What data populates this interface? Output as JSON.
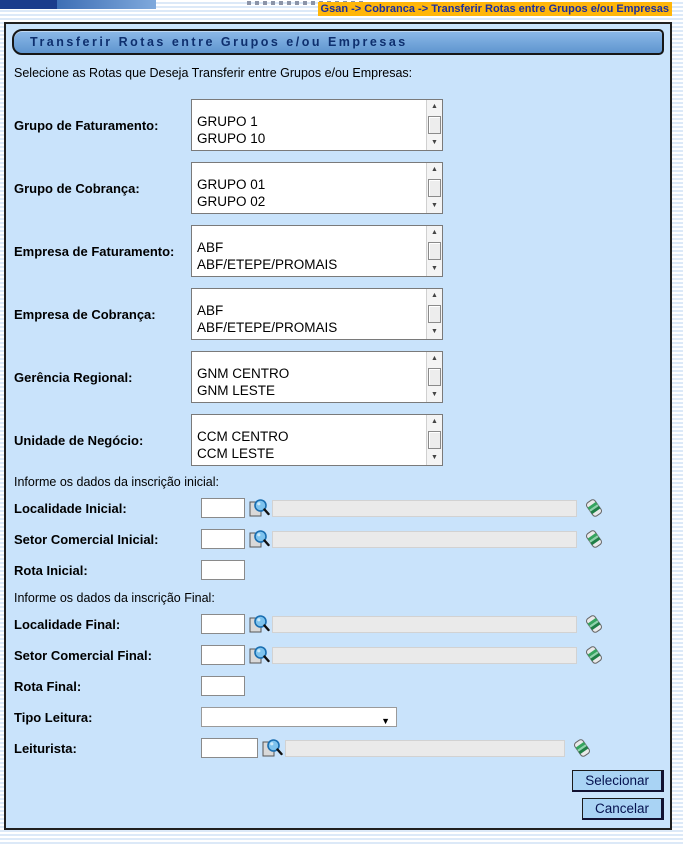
{
  "header": {
    "breadcrumb": "Gsan -> Cobranca -> Transferir Rotas entre Grupos e/ou Empresas"
  },
  "page": {
    "title": "Transferir Rotas entre Grupos e/ou Empresas",
    "instruction": "Selecione as Rotas que Deseja Transferir entre Grupos e/ou Empresas:"
  },
  "listboxes": [
    {
      "label": "Grupo de Faturamento:",
      "items": [
        "GRUPO 1",
        "GRUPO 10"
      ]
    },
    {
      "label": "Grupo de Cobrança:",
      "items": [
        "GRUPO 01",
        "GRUPO 02"
      ]
    },
    {
      "label": "Empresa de Faturamento:",
      "items": [
        "ABF",
        "ABF/ETEPE/PROMAIS"
      ]
    },
    {
      "label": "Empresa de Cobrança:",
      "items": [
        "ABF",
        "ABF/ETEPE/PROMAIS"
      ]
    },
    {
      "label": "Gerência Regional:",
      "items": [
        "GNM CENTRO",
        "GNM LESTE"
      ]
    },
    {
      "label": "Unidade de Negócio:",
      "items": [
        "CCM CENTRO",
        "CCM LESTE"
      ]
    }
  ],
  "sections": {
    "inicial": "Informe os dados da inscrição inicial:",
    "final": "Informe os dados da inscrição Final:"
  },
  "fields": {
    "localidade_inicial": {
      "label": "Localidade Inicial:",
      "code": "",
      "description": ""
    },
    "setor_inicial": {
      "label": "Setor Comercial Inicial:",
      "code": "",
      "description": ""
    },
    "rota_inicial": {
      "label": "Rota Inicial:",
      "value": ""
    },
    "localidade_final": {
      "label": "Localidade Final:",
      "code": "",
      "description": ""
    },
    "setor_final": {
      "label": "Setor Comercial Final:",
      "code": "",
      "description": ""
    },
    "rota_final": {
      "label": "Rota Final:",
      "value": ""
    },
    "tipo_leitura": {
      "label": "Tipo Leitura:",
      "selected": ""
    },
    "leiturista": {
      "label": "Leiturista:",
      "code": "",
      "description": ""
    }
  },
  "icons": {
    "scroll_up": "▲",
    "scroll_down": "▼",
    "dropdown_arrow": "▼",
    "search": "magnifier-over-document",
    "eraser": "green-eraser"
  },
  "buttons": {
    "selecionar": "Selecionar",
    "cancelar": "Cancelar"
  },
  "colors": {
    "panel_bg": "#C9E3FB",
    "breadcrumb_bg": "#FFB60A",
    "breadcrumb_text": "#1D2F9D",
    "titlebar_gradient_top": "#8CB9E8",
    "titlebar_gradient_bottom": "#5F95CF",
    "title_text": "#0E2F6E",
    "button_bg": "#A9D3F4",
    "button_text": "#05124F",
    "disabled_field_bg": "#EAEAEA"
  }
}
